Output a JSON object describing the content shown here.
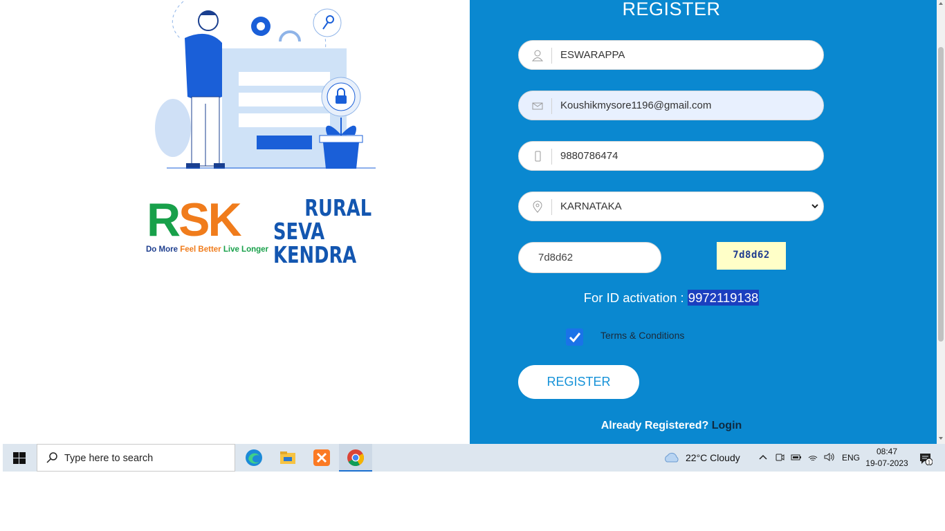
{
  "brand": {
    "logo_letters": [
      "R",
      "S",
      "K"
    ],
    "tagline": [
      "Do More",
      "Feel Better",
      "Live Longer"
    ],
    "name_line1": "RURAL",
    "name_line2": "SEVA KENDRA",
    "colors": {
      "green": "#18a04a",
      "orange": "#f07c1c",
      "blue": "#1356b0"
    }
  },
  "form": {
    "title": "REGISTER",
    "name_value": "ESWARAPPA",
    "email_value": "Koushikmysore1196@gmail.com",
    "phone_value": "9880786474",
    "state_value": "KARNATAKA",
    "captcha_input_value": "7d8d62",
    "captcha_code": "7d8d62",
    "activation_label": "For ID activation : ",
    "activation_number": "9972119138",
    "terms_label": "Terms & Conditions",
    "terms_checked": true,
    "register_button": "REGISTER",
    "already_text": "Already Registered? ",
    "login_link": "Login",
    "panel_color": "#0a88d0",
    "icons": [
      "user-icon",
      "mail-icon",
      "phone-icon",
      "location-icon"
    ]
  },
  "taskbar": {
    "search_placeholder": "Type here to search",
    "pinned": [
      "edge-icon",
      "file-explorer-icon",
      "xampp-icon",
      "chrome-icon"
    ],
    "weather": "22°C  Cloudy",
    "language": "ENG",
    "time": "08:47",
    "date": "19-07-2023",
    "notification_count": "1"
  }
}
